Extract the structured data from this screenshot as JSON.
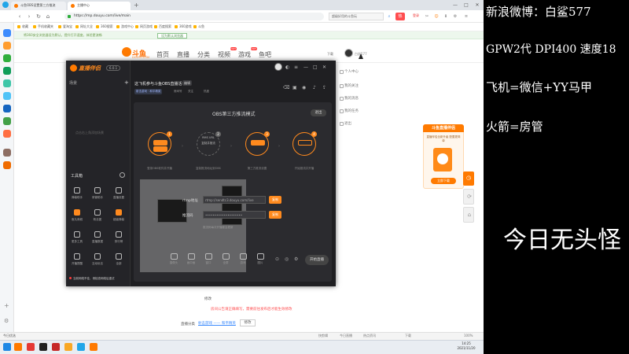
{
  "browser": {
    "tabs": [
      {
        "label": "斗鱼OBS设置第三方推流",
        "active": false
      },
      {
        "label": "主播中心",
        "active": true
      }
    ],
    "window_controls": [
      "—",
      "□",
      "✕"
    ],
    "url": "https://mp.douyu.com/live/main",
    "search_placeholder": "超级好用的斗鱼玩",
    "login_label": "登录",
    "bookmarks": [
      "收藏",
      "手机收藏夹",
      "爱淘宝",
      "网址大全",
      "360搜索",
      "游戏中心",
      "网页游戏",
      "百度搜索",
      "360游戏",
      "斗鱼"
    ],
    "notice": "将360安全浏览器设为默认，提升打开速度，体验更流畅",
    "notice_button": "设为默认浏览器"
  },
  "site": {
    "logo_text": "斗鱼",
    "logo_sub": "DOUYU.COM",
    "nav": [
      "首页",
      "直播",
      "分类",
      "视频",
      "游戏",
      "鱼吧"
    ],
    "download_label": "下载",
    "username": "白鲨577",
    "dropdown": [
      "个人中心",
      "我的关注",
      "我的消息",
      "我的任务",
      "退出"
    ]
  },
  "promo": {
    "title": "斗鱼直播伴侣",
    "text": "直播伴侣全新升级 配置更简单",
    "button": "立即下载"
  },
  "page_lower": {
    "modify_label": "修改",
    "warning": "房间公告请正确填写，需要前往发布后才能生效修改",
    "category_label": "直播分类",
    "category_link": "射击游戏 —— 和平精英",
    "category_button": "修改"
  },
  "statusbar": {
    "left": "今日优选",
    "items": [
      "快剪辑",
      "今日直播",
      "热点资讯",
      "下载",
      "100%"
    ]
  },
  "taskbar": {
    "time": "14:25",
    "date": "2021/11/20"
  },
  "app": {
    "title": "直播伴侣",
    "version": "6.0.1",
    "scene_header": "场景",
    "scene_empty": "点击右上角添加场景",
    "tools_header": "工具箱",
    "tools": [
      {
        "label": "弹幕助手",
        "orange": false
      },
      {
        "label": "房管助手",
        "orange": false
      },
      {
        "label": "直播设置",
        "orange": false
      },
      {
        "label": "鱼丸商城",
        "orange": true
      },
      {
        "label": "粉丝团",
        "orange": false
      },
      {
        "label": "超级弹幕",
        "orange": true
      },
      {
        "label": "更多工具",
        "orange": false
      },
      {
        "label": "直播数据",
        "orange": false
      },
      {
        "label": "排行榜",
        "orange": false
      },
      {
        "label": "开播提醒",
        "orange": false
      },
      {
        "label": "互动玩法",
        "orange": false
      },
      {
        "label": "全部",
        "orange": false
      }
    ],
    "side_foot": "当前网络不佳，请检查网络后重试",
    "room_title": "这飞机参与斗鱼OBS直播活动",
    "room_edit": "编辑",
    "room_category": "射击游戏 · 和平精英",
    "room_id": "房间号",
    "room_fans": "关注",
    "room_hot": "热度",
    "obs_title": "OBS第三方推流模式",
    "obs_exit": "退出",
    "steps": [
      {
        "caption": "登录OBS软件并开播",
        "on": true
      },
      {
        "caption": "复制推流地址到OBS",
        "on": false
      },
      {
        "caption": "第三方推流设置",
        "on": true
      },
      {
        "caption": "开始推流并开播",
        "on": true
      }
    ],
    "step2_label1": "RMS URL",
    "step2_label2": "复制并推流",
    "rtmp_label": "rtmp地址",
    "rtmp_value": "rtmp://sendtc3.douyu.com/live",
    "copy_label": "复制",
    "code_label": "推流码",
    "code_value": "••••••••••••••••••••",
    "obs_hint": "推流码每次开播都会更新",
    "bottom_tools": [
      "摄像头",
      "画中画",
      "窗口",
      "全屏",
      "游戏",
      "图片"
    ],
    "live_button": "开始直播"
  },
  "overlay": {
    "line1": "新浪微博：白鲨577",
    "line2": "GPW2代 DPI400 速度18",
    "line3": "飞机=微信+YY马甲",
    "line4": "火箭=房管",
    "line5": "今日无头怪"
  }
}
